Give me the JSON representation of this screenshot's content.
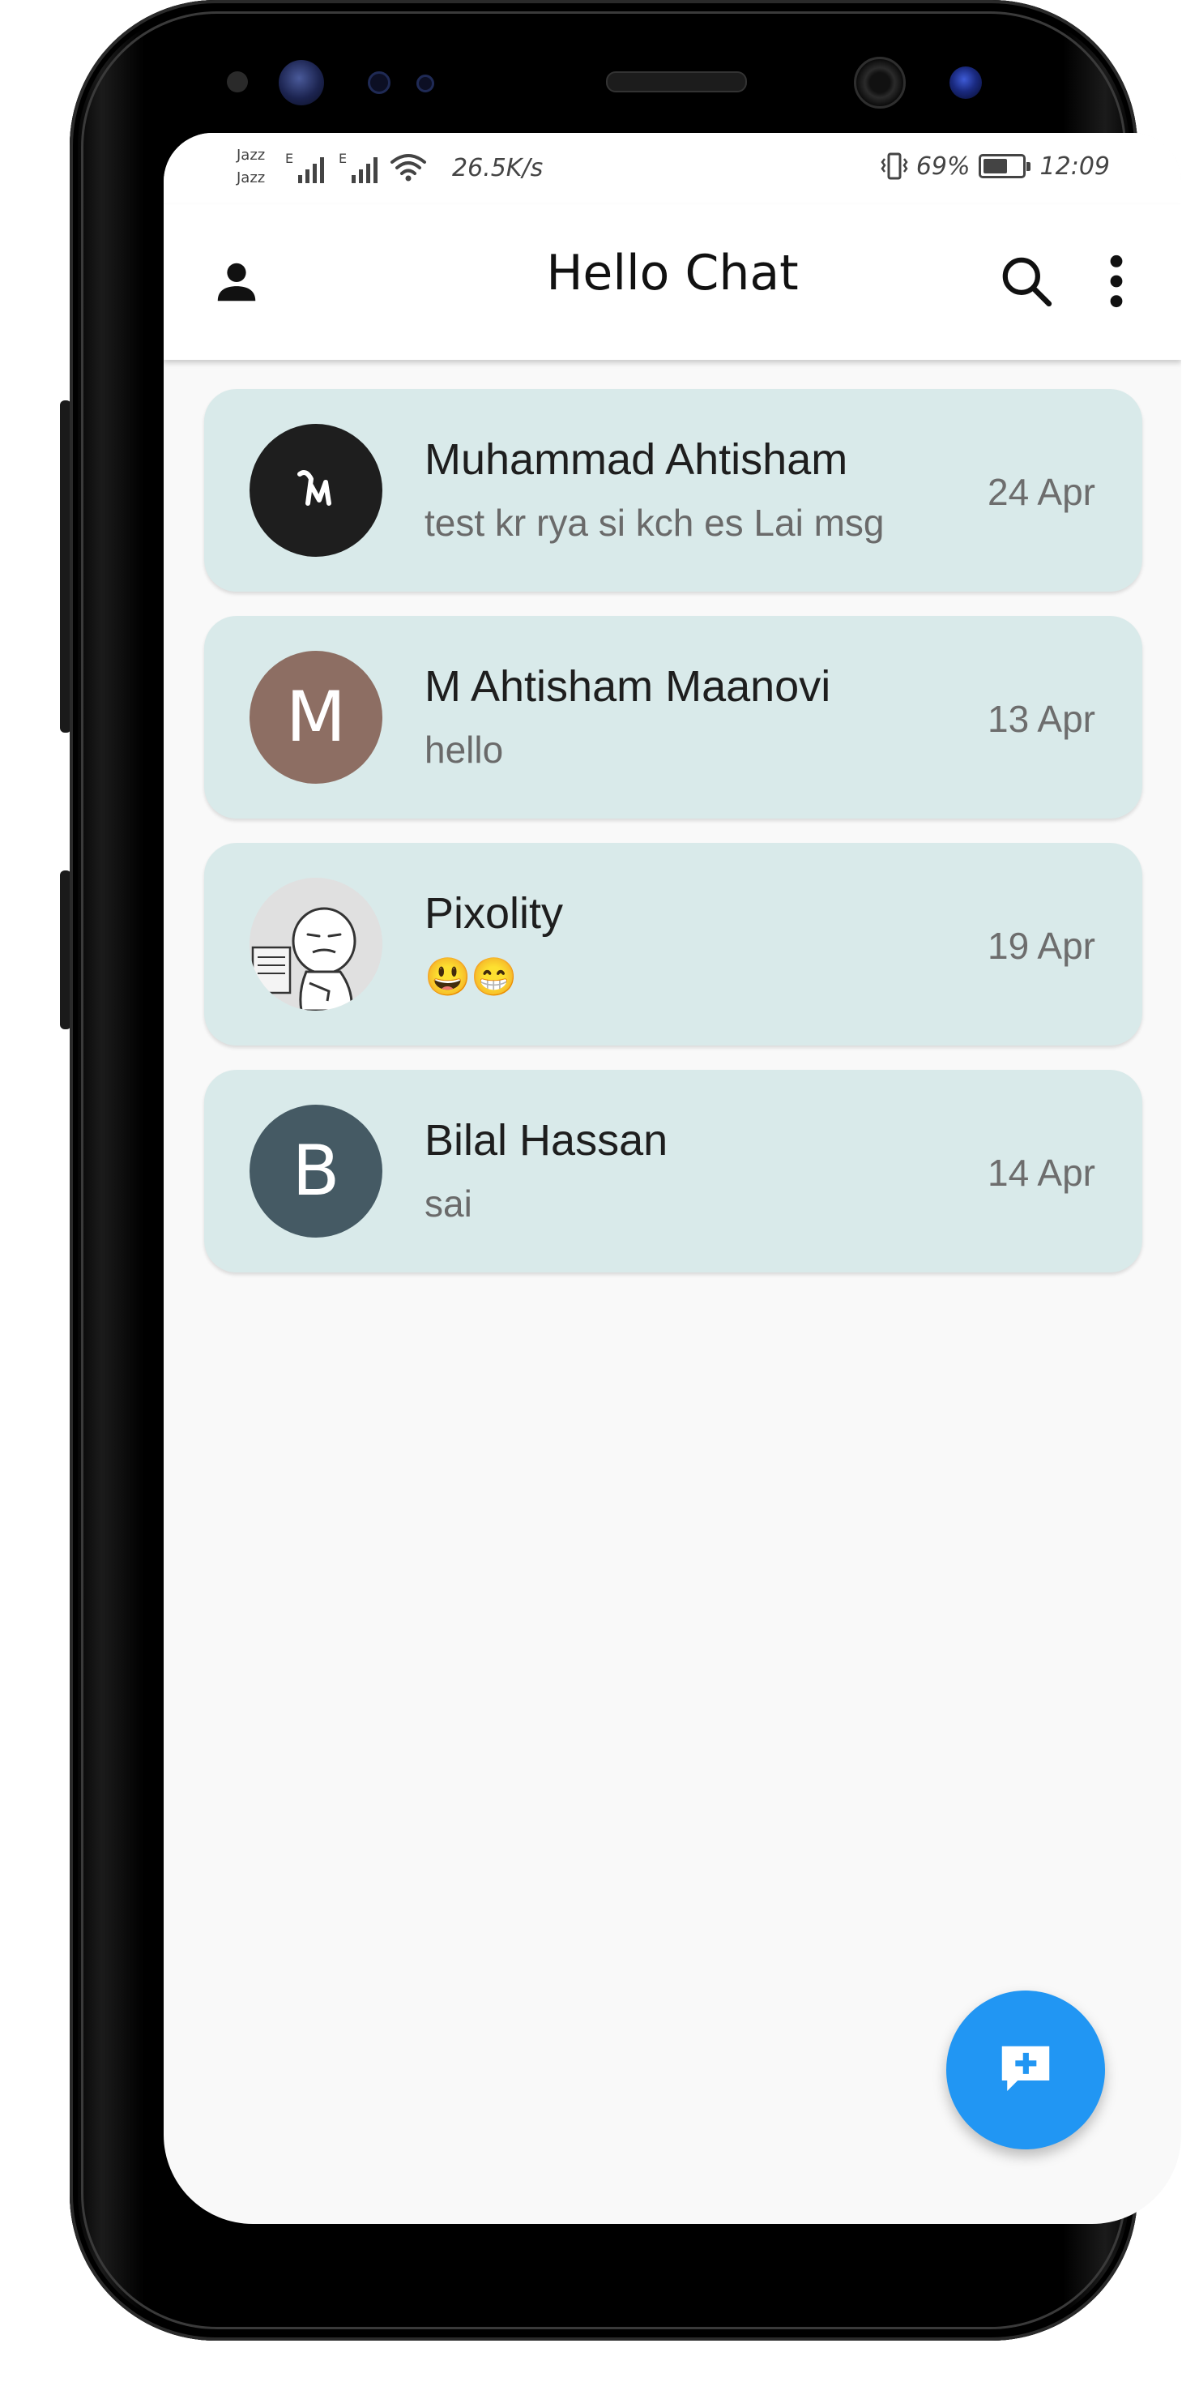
{
  "status_bar": {
    "carrier_1": "Jazz",
    "carrier_2": "Jazz",
    "network_1": "E",
    "network_2": "E",
    "speed": "26.5K/s",
    "battery_percent": "69%",
    "battery_level": 0.69,
    "time": "12:09"
  },
  "appbar": {
    "title": "Hello Chat",
    "profile_icon": "person-icon",
    "search_icon": "search-icon",
    "menu_icon": "more-vert-icon"
  },
  "chats": [
    {
      "name": "Muhammad Ahtisham",
      "last_message": "test kr rya si kch es Lai msg",
      "date": "24 Apr",
      "avatar_type": "logo",
      "avatar_color": "#1e1e1e"
    },
    {
      "name": "M Ahtisham Maanovi",
      "last_message": "hello",
      "date": "13 Apr",
      "avatar_type": "letter",
      "avatar_letter": "M",
      "avatar_color": "#8d6e63"
    },
    {
      "name": "Pixolity",
      "last_message": "😃😁",
      "date": "19 Apr",
      "avatar_type": "image",
      "avatar_color": "#e0e0e0"
    },
    {
      "name": "Bilal Hassan",
      "last_message": "sai",
      "date": "14 Apr",
      "avatar_type": "letter",
      "avatar_letter": "B",
      "avatar_color": "#455a64"
    }
  ],
  "fab": {
    "icon": "new-chat-icon",
    "color": "#2196f3"
  },
  "colors": {
    "card_background": "#d9eaea",
    "screen_background": "#f9f9f9",
    "appbar_background": "#ffffff"
  }
}
